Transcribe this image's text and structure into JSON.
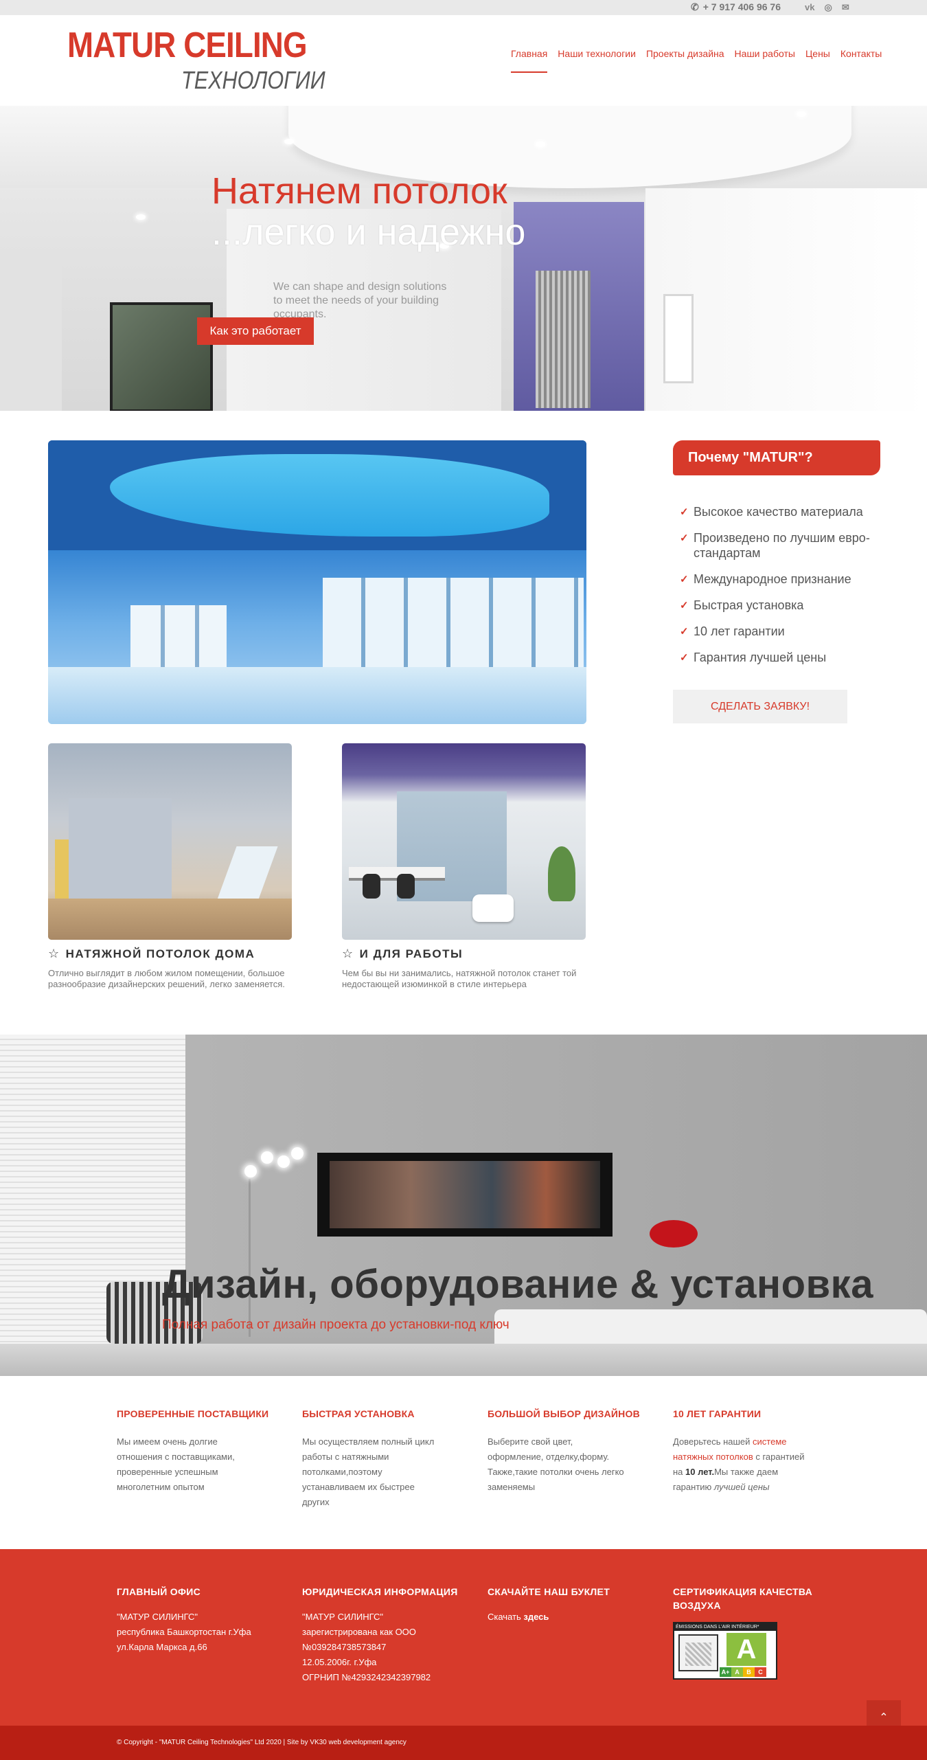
{
  "topbar": {
    "phone": "+ 7 917 406 96 76",
    "phone_icon": "phone-icon",
    "social": [
      {
        "icon": "vk-icon",
        "glyph": "vk"
      },
      {
        "icon": "instagram-icon",
        "glyph": "◎"
      },
      {
        "icon": "mail-icon",
        "glyph": "✉"
      }
    ]
  },
  "header": {
    "logo_main": "MATUR CEILING",
    "logo_sub": "ТЕХНОЛОГИИ",
    "nav": [
      {
        "label": "Главная",
        "active": true
      },
      {
        "label": "Наши технологии"
      },
      {
        "label": "Проекты дизайна"
      },
      {
        "label": "Наши работы"
      },
      {
        "label": "Цены"
      },
      {
        "label": "Контакты"
      }
    ]
  },
  "hero": {
    "title_line1": "Натянем потолок",
    "title_line2": "...легко и надежно",
    "glass_text": [
      "We can shape and design solutions",
      "to meet the needs of your building",
      "occupants."
    ],
    "button": "Как это работает"
  },
  "cards": [
    {
      "title": "НАТЯЖНОЙ ПОТОЛОК ДОМА",
      "desc": "Отлично выглядит в любом жилом помещении, большое разнообразие дизайнерских решений, легко заменяется."
    },
    {
      "title": "И ДЛЯ РАБОТЫ",
      "desc": "Чем бы вы ни занимались, натяжной потолок станет той недостающей изюминкой в стиле интерьера"
    }
  ],
  "sidebar": {
    "why_title": "Почему \"MATUR\"?",
    "items": [
      "Высокое качество материала",
      "Произведено по лучшим евро-стандартам",
      "Международное признание",
      "Быстрая установка",
      "10 лет гарантии",
      "Гарантия лучшей цены"
    ],
    "order_button": "СДЕЛАТЬ ЗАЯВКУ!"
  },
  "banner": {
    "title": "Дизайн, оборудование & установка",
    "subtitle": "Полная работа от дизайн проекта до установки-под ключ"
  },
  "features": [
    {
      "title": "ПРОВЕРЕННЫЕ ПОСТАВЩИКИ",
      "text": "Мы имеем очень долгие отношения с поставщиками, проверенные успешным многолетним опытом"
    },
    {
      "title": "БЫСТРАЯ УСТАНОВКА",
      "text": "Мы осуществляем полный цикл работы с натяжными потолками,поэтому устанавливаем их быстрее других"
    },
    {
      "title": "БОЛЬШОЙ ВЫБОР ДИЗАЙНОВ",
      "text": "Выберите свой цвет, оформление, отделку,форму. Также,такие потолки очень легко заменяемы"
    },
    {
      "title": "10 ЛЕТ ГАРАНТИИ",
      "text_a": "Доверьтесь нашей ",
      "link": "системе натяжных потолков",
      "text_b": " с гарантией на ",
      "bold": "10 лет.",
      "text_c": "Мы также даем гарантию ",
      "italic": "лучшей цены"
    }
  ],
  "footer": {
    "office": {
      "title": "ГЛАВНЫЙ ОФИС",
      "lines": [
        "\"МАТУР СИЛИНГС\"",
        "республика Башкортостан г.Уфа",
        "ул.Карла Маркса д.66"
      ]
    },
    "legal": {
      "title": "ЮРИДИЧЕСКАЯ ИНФОРМАЦИЯ",
      "lines": [
        "\"МАТУР СИЛИНГС\"",
        "зарегистрирована как ООО",
        "№039284738573847",
        "12.05.2006г. г.Уфа",
        "ОГРНИП №4293242342397982"
      ]
    },
    "booklet": {
      "title": "СКАЧАЙТЕ НАШ БУКЛЕТ",
      "text": "Скачать ",
      "link": "здесь"
    },
    "cert": {
      "title": "СЕРТИФИКАЦИЯ КАЧЕСТВА ВОЗДУХА",
      "badge_top": "ÉMISSIONS DANS L'AIR INTÉRIEUR*",
      "grade": "A",
      "scale": [
        "A+",
        "A",
        "B",
        "C"
      ],
      "scale_colors": [
        "#3a9a3c",
        "#8cbf3f",
        "#f2b705",
        "#e0452e"
      ]
    },
    "to_top_icon": "chevron-up-icon",
    "copyright": "© Copyright - \"MATUR Ceiling Technologies\" Ltd 2020 | Site by VK30 web development agency"
  },
  "colors": {
    "accent": "#d73a2b",
    "footer_bg": "#d73a2b",
    "copyright_bg": "#b81f14"
  }
}
